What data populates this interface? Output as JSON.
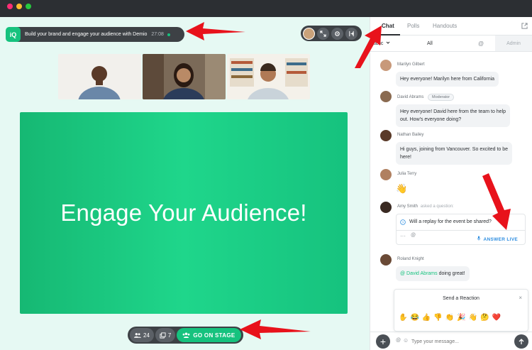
{
  "window": {
    "traffic_colors": [
      "#ff2d75",
      "#ffbd2e",
      "#27c93f"
    ]
  },
  "event": {
    "logo": "iQ",
    "title": "Build your brand and engage your audience with Demio",
    "time": "27:08"
  },
  "slide": {
    "text": "Engage Your Audience!"
  },
  "bottom_bar": {
    "attendees_count": "24",
    "handouts_count": "7",
    "go_on_stage_label": "GO ON STAGE"
  },
  "panel": {
    "tabs": [
      "Chat",
      "Polls",
      "Handouts"
    ],
    "filters": {
      "public": "ublic",
      "all": "All",
      "admin": "Admin"
    },
    "messages": [
      {
        "name": "Marilyn Gilbert",
        "text": "Hey everyone! Marilyn here from California"
      },
      {
        "name": "David Abrams",
        "badge": "Moderator",
        "text_line1": "Hey everyone! David here from the team to help",
        "text_line2": "out. How's everyone doing?"
      },
      {
        "name": "Nathan Bailey",
        "text_line1": "Hi guys, joining from Vancouver. So excited to be",
        "text_line2": "here!"
      },
      {
        "name": "Julia Terry",
        "text": "👋"
      },
      {
        "name": "Amy Smith",
        "suffix": "asked a question:",
        "text": "Will a replay for the event be shared?",
        "answer_label": "ANSWER LIVE"
      },
      {
        "name": "Roland Knight",
        "mention": "@ David Abrams",
        "text": " doing great!"
      }
    ],
    "reaction": {
      "title": "Send a Reaction",
      "emojis": [
        "✋",
        "😂",
        "👍",
        "👎",
        "👏",
        "🎉",
        "👋",
        "🤔",
        "❤️"
      ]
    },
    "composer": {
      "placeholder": "Type your message..."
    }
  },
  "colors": {
    "accent": "#16c27e",
    "link": "#2f8ee0",
    "annotation": "#e8121b"
  }
}
